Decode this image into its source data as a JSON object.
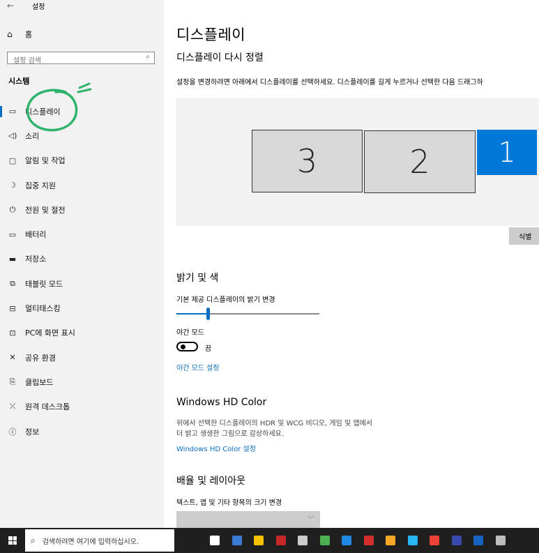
{
  "window": {
    "title": "설정",
    "back_icon": "back-arrow-icon"
  },
  "sidebar": {
    "home_label": "홈",
    "search_placeholder": "설정 검색",
    "section_title": "시스템",
    "items": [
      {
        "label": "디스플레이",
        "icon": "monitor-icon",
        "active": true
      },
      {
        "label": "소리",
        "icon": "speaker-icon"
      },
      {
        "label": "알림 및 작업",
        "icon": "notification-icon"
      },
      {
        "label": "집중 지원",
        "icon": "moon-icon"
      },
      {
        "label": "전원 및 절전",
        "icon": "power-icon"
      },
      {
        "label": "배터리",
        "icon": "battery-icon"
      },
      {
        "label": "저장소",
        "icon": "storage-icon"
      },
      {
        "label": "태블릿 모드",
        "icon": "tablet-icon"
      },
      {
        "label": "멀티태스킹",
        "icon": "multitasking-icon"
      },
      {
        "label": "PC에 화면 표시",
        "icon": "project-icon"
      },
      {
        "label": "공유 환경",
        "icon": "shared-experiences-icon"
      },
      {
        "label": "클립보드",
        "icon": "clipboard-icon"
      },
      {
        "label": "원격 데스크톱",
        "icon": "remote-desktop-icon"
      },
      {
        "label": "정보",
        "icon": "info-icon"
      }
    ]
  },
  "main": {
    "page_title": "디스플레이",
    "rearrange_title": "디스플레이 다시 정렬",
    "rearrange_desc": "설정을 변경하려면 아래에서 디스플레이를 선택하세요. 디스플레이를 길게 누르거나 선택한 다음 드래그하",
    "monitors": [
      {
        "number": "3",
        "selected": false
      },
      {
        "number": "2",
        "selected": false
      },
      {
        "number": "1",
        "selected": true
      }
    ],
    "identify_label": "식별",
    "brightness_section": "밝기 및 색",
    "brightness_label": "기본 제공 디스플레이의 밝기 변경",
    "brightness_value_pct": 22,
    "night_mode_label": "야간 모드",
    "night_mode_state": "끔",
    "night_mode_settings_link": "야간 모드 설정",
    "hd_color_title": "Windows HD Color",
    "hd_color_desc_1": "위에서 선택한 디스플레이의 HDR 및 WCG 비디오, 게임 및 앱에서",
    "hd_color_desc_2": "더 밝고 생생한 그림으로 감상하세요.",
    "hd_color_link": "Windows HD Color 설정",
    "scale_section": "배율 및 레이아웃",
    "scale_label": "텍스트, 앱 및 기타 항목의 크기 변경"
  },
  "taskbar": {
    "search_placeholder": "검색하려면 여기에 입력하십시오.",
    "icons": [
      {
        "name": "task-view-icon",
        "color": "#ffffff"
      },
      {
        "name": "calculator-icon",
        "color": "#3a7bd5"
      },
      {
        "name": "file-explorer-icon",
        "color": "#f2c200"
      },
      {
        "name": "pinned-app-red-icon",
        "color": "#c62828"
      },
      {
        "name": "command-prompt-icon",
        "color": "#cccccc"
      },
      {
        "name": "utorrent-icon",
        "color": "#4caf50"
      },
      {
        "name": "photos-app-icon",
        "color": "#1e88e5"
      },
      {
        "name": "pinned-app-flag-icon",
        "color": "#d32f2f"
      },
      {
        "name": "media-player-icon",
        "color": "#f9a825"
      },
      {
        "name": "settings-app-icon",
        "color": "#29b6f6"
      },
      {
        "name": "chrome-icon",
        "color": "#ea4335"
      },
      {
        "name": "dev-app-icon",
        "color": "#3949ab"
      },
      {
        "name": "settings-window-icon",
        "color": "#1565c0"
      },
      {
        "name": "user-avatar-icon",
        "color": "#bdbdbd"
      }
    ]
  }
}
